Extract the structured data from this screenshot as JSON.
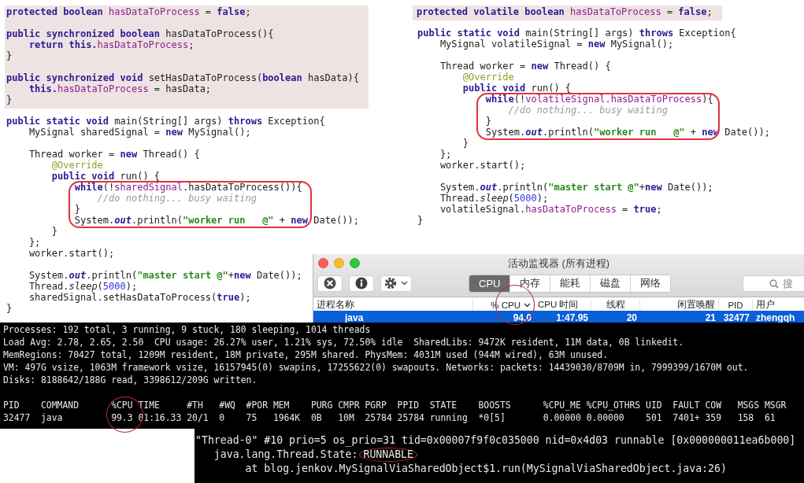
{
  "snippets": [
    {
      "blocks": [
        {
          "kind": "shaded",
          "lines": [
            {
              "kind": "code",
              "segments": [
                {
                  "kind": "kw",
                  "text": "protected boolean "
                },
                {
                  "kind": "field",
                  "text": "hasDataToProcess"
                },
                {
                  "kind": "plain",
                  "text": " = "
                },
                {
                  "kind": "kw",
                  "text": "false"
                },
                {
                  "kind": "plain",
                  "text": ";"
                }
              ]
            },
            {
              "kind": "blank"
            },
            {
              "kind": "code",
              "segments": [
                {
                  "kind": "kw",
                  "text": "public synchronized boolean "
                },
                {
                  "kind": "plain",
                  "text": "hasDataToProcess(){"
                }
              ]
            },
            {
              "kind": "code",
              "segments": [
                {
                  "kind": "kw",
                  "text": "    return this."
                },
                {
                  "kind": "field",
                  "text": "hasDataToProcess"
                },
                {
                  "kind": "plain",
                  "text": ";"
                }
              ]
            },
            {
              "kind": "code",
              "segments": [
                {
                  "kind": "plain",
                  "text": "}"
                }
              ]
            },
            {
              "kind": "blank"
            },
            {
              "kind": "code",
              "segments": [
                {
                  "kind": "kw",
                  "text": "public synchronized void "
                },
                {
                  "kind": "plain",
                  "text": "setHasDataToProcess("
                },
                {
                  "kind": "kw",
                  "text": "boolean"
                },
                {
                  "kind": "plain",
                  "text": " hasData){"
                }
              ]
            },
            {
              "kind": "code",
              "segments": [
                {
                  "kind": "kw",
                  "text": "    this."
                },
                {
                  "kind": "field",
                  "text": "hasDataToProcess"
                },
                {
                  "kind": "plain",
                  "text": " = hasData;"
                }
              ]
            },
            {
              "kind": "code",
              "segments": [
                {
                  "kind": "plain",
                  "text": "}"
                }
              ]
            }
          ]
        },
        {
          "kind": "plain",
          "lines": [
            {
              "kind": "blank"
            },
            {
              "kind": "code",
              "segments": [
                {
                  "kind": "kw",
                  "text": "public static void "
                },
                {
                  "kind": "plain",
                  "text": "main(String[] args) "
                },
                {
                  "kind": "kw",
                  "text": "throws"
                },
                {
                  "kind": "plain",
                  "text": " Exception{"
                }
              ]
            },
            {
              "kind": "code",
              "segments": [
                {
                  "kind": "plain",
                  "text": "    MySignal sharedSignal = "
                },
                {
                  "kind": "kw",
                  "text": "new"
                },
                {
                  "kind": "plain",
                  "text": " MySignal();"
                }
              ]
            },
            {
              "kind": "blank"
            },
            {
              "kind": "code",
              "segments": [
                {
                  "kind": "plain",
                  "text": "    Thread worker = "
                },
                {
                  "kind": "kw",
                  "text": "new"
                },
                {
                  "kind": "plain",
                  "text": " Thread() {"
                }
              ]
            },
            {
              "kind": "code",
              "segments": [
                {
                  "kind": "annotation",
                  "text": "        @Override"
                }
              ]
            },
            {
              "kind": "code",
              "segments": [
                {
                  "kind": "kw",
                  "text": "        public void"
                },
                {
                  "kind": "plain",
                  "text": " run() {"
                }
              ]
            }
          ]
        },
        {
          "kind": "circled",
          "lines": [
            {
              "kind": "code",
              "segments": [
                {
                  "kind": "kw",
                  "text": "            while"
                },
                {
                  "kind": "plain",
                  "text": "(!"
                },
                {
                  "kind": "field",
                  "text": "sharedSignal"
                },
                {
                  "kind": "plain",
                  "text": ".hasDataToProcess()){"
                }
              ]
            },
            {
              "kind": "code",
              "segments": [
                {
                  "kind": "comment",
                  "text": "                //do nothing... busy waiting"
                }
              ]
            },
            {
              "kind": "code",
              "segments": [
                {
                  "kind": "plain",
                  "text": "            }"
                }
              ]
            },
            {
              "kind": "code",
              "segments": [
                {
                  "kind": "plain",
                  "text": "            System."
                },
                {
                  "kind": "static_field",
                  "text": "out"
                },
                {
                  "kind": "plain",
                  "text": ".println("
                },
                {
                  "kind": "string",
                  "text": "\"worker run   @\""
                },
                {
                  "kind": "plain",
                  "text": " + "
                },
                {
                  "kind": "kw",
                  "text": "new"
                },
                {
                  "kind": "plain",
                  "text": " Date());"
                }
              ]
            }
          ]
        },
        {
          "kind": "plain",
          "lines": [
            {
              "kind": "code",
              "segments": [
                {
                  "kind": "plain",
                  "text": "        }"
                }
              ]
            },
            {
              "kind": "code",
              "segments": [
                {
                  "kind": "plain",
                  "text": "    };"
                }
              ]
            },
            {
              "kind": "code",
              "segments": [
                {
                  "kind": "plain",
                  "text": "    worker.start();"
                }
              ]
            },
            {
              "kind": "blank"
            },
            {
              "kind": "code",
              "segments": [
                {
                  "kind": "plain",
                  "text": "    System."
                },
                {
                  "kind": "static_field",
                  "text": "out"
                },
                {
                  "kind": "plain",
                  "text": ".println("
                },
                {
                  "kind": "string",
                  "text": "\"master start @\""
                },
                {
                  "kind": "plain",
                  "text": "+"
                },
                {
                  "kind": "kw",
                  "text": "new"
                },
                {
                  "kind": "plain",
                  "text": " Date());"
                }
              ]
            },
            {
              "kind": "code",
              "segments": [
                {
                  "kind": "plain",
                  "text": "    Thread."
                },
                {
                  "kind": "static_method",
                  "text": "sleep"
                },
                {
                  "kind": "plain",
                  "text": "("
                },
                {
                  "kind": "number",
                  "text": "5000"
                },
                {
                  "kind": "plain",
                  "text": ");"
                }
              ]
            },
            {
              "kind": "code",
              "segments": [
                {
                  "kind": "plain",
                  "text": "    sharedSignal.setHasDataToProcess("
                },
                {
                  "kind": "kw",
                  "text": "true"
                },
                {
                  "kind": "plain",
                  "text": ");"
                }
              ]
            },
            {
              "kind": "code",
              "segments": [
                {
                  "kind": "plain",
                  "text": "}"
                }
              ]
            }
          ]
        }
      ]
    },
    {
      "blocks": [
        {
          "kind": "shaded",
          "lines": [
            {
              "kind": "code",
              "segments": [
                {
                  "kind": "kw",
                  "text": "protected volatile boolean "
                },
                {
                  "kind": "field",
                  "text": "hasDataToProcess"
                },
                {
                  "kind": "plain",
                  "text": " = "
                },
                {
                  "kind": "kw",
                  "text": "false"
                },
                {
                  "kind": "plain",
                  "text": ";"
                }
              ]
            }
          ]
        },
        {
          "kind": "plain",
          "lines": [
            {
              "kind": "blank"
            },
            {
              "kind": "code",
              "segments": [
                {
                  "kind": "kw",
                  "text": "public static void "
                },
                {
                  "kind": "plain",
                  "text": "main(String[] args) "
                },
                {
                  "kind": "kw",
                  "text": "throws"
                },
                {
                  "kind": "plain",
                  "text": " Exception{"
                }
              ]
            },
            {
              "kind": "code",
              "segments": [
                {
                  "kind": "plain",
                  "text": "    MySignal volatileSignal = "
                },
                {
                  "kind": "kw",
                  "text": "new"
                },
                {
                  "kind": "plain",
                  "text": " MySignal();"
                }
              ]
            },
            {
              "kind": "blank"
            },
            {
              "kind": "code",
              "segments": [
                {
                  "kind": "plain",
                  "text": "    Thread worker = "
                },
                {
                  "kind": "kw",
                  "text": "new"
                },
                {
                  "kind": "plain",
                  "text": " Thread() {"
                }
              ]
            },
            {
              "kind": "code",
              "segments": [
                {
                  "kind": "annotation",
                  "text": "        @Override"
                }
              ]
            },
            {
              "kind": "code",
              "segments": [
                {
                  "kind": "kw",
                  "text": "        public void"
                },
                {
                  "kind": "plain",
                  "text": " run() {"
                }
              ]
            }
          ]
        },
        {
          "kind": "circled",
          "lines": [
            {
              "kind": "code",
              "segments": [
                {
                  "kind": "kw",
                  "text": "            while"
                },
                {
                  "kind": "plain",
                  "text": "(!"
                },
                {
                  "kind": "field",
                  "text": "volatileSignal.hasDataToProcess"
                },
                {
                  "kind": "plain",
                  "text": "){"
                }
              ]
            },
            {
              "kind": "code",
              "segments": [
                {
                  "kind": "comment",
                  "text": "                //do nothing... busy waiting"
                }
              ]
            },
            {
              "kind": "code",
              "segments": [
                {
                  "kind": "plain",
                  "text": "            }"
                }
              ]
            },
            {
              "kind": "code",
              "segments": [
                {
                  "kind": "plain",
                  "text": "            System."
                },
                {
                  "kind": "static_field",
                  "text": "out"
                },
                {
                  "kind": "plain",
                  "text": ".println("
                },
                {
                  "kind": "string",
                  "text": "\"worker run   @\""
                },
                {
                  "kind": "plain",
                  "text": " + "
                },
                {
                  "kind": "kw",
                  "text": "new"
                },
                {
                  "kind": "plain",
                  "text": " Date());"
                }
              ]
            }
          ]
        },
        {
          "kind": "plain",
          "lines": [
            {
              "kind": "code",
              "segments": [
                {
                  "kind": "plain",
                  "text": "        }"
                }
              ]
            },
            {
              "kind": "code",
              "segments": [
                {
                  "kind": "plain",
                  "text": "    };"
                }
              ]
            },
            {
              "kind": "code",
              "segments": [
                {
                  "kind": "plain",
                  "text": "    worker.start();"
                }
              ]
            },
            {
              "kind": "blank"
            },
            {
              "kind": "code",
              "segments": [
                {
                  "kind": "plain",
                  "text": "    System."
                },
                {
                  "kind": "static_field",
                  "text": "out"
                },
                {
                  "kind": "plain",
                  "text": ".println("
                },
                {
                  "kind": "string",
                  "text": "\"master start @\""
                },
                {
                  "kind": "plain",
                  "text": "+"
                },
                {
                  "kind": "kw",
                  "text": "new"
                },
                {
                  "kind": "plain",
                  "text": " Date());"
                }
              ]
            },
            {
              "kind": "code",
              "segments": [
                {
                  "kind": "plain",
                  "text": "    Thread."
                },
                {
                  "kind": "static_method",
                  "text": "sleep"
                },
                {
                  "kind": "plain",
                  "text": "("
                },
                {
                  "kind": "number",
                  "text": "5000"
                },
                {
                  "kind": "plain",
                  "text": ");"
                }
              ]
            },
            {
              "kind": "code",
              "segments": [
                {
                  "kind": "plain",
                  "text": "    volatileSignal."
                },
                {
                  "kind": "field",
                  "text": "hasDataToProcess"
                },
                {
                  "kind": "plain",
                  "text": " = "
                },
                {
                  "kind": "kw",
                  "text": "true"
                },
                {
                  "kind": "plain",
                  "text": ";"
                }
              ]
            },
            {
              "kind": "code",
              "segments": [
                {
                  "kind": "plain",
                  "text": "}"
                }
              ]
            }
          ]
        }
      ]
    }
  ],
  "activity_monitor": {
    "title": "活动监视器 (所有进程)",
    "tabs": [
      {
        "label": "CPU",
        "selected": true
      },
      {
        "label": "内存",
        "selected": false
      },
      {
        "label": "能耗",
        "selected": false
      },
      {
        "label": "磁盘",
        "selected": false
      },
      {
        "label": "网络",
        "selected": false
      }
    ],
    "search": {
      "placeholder": "搜"
    },
    "columns": [
      {
        "label": "进程名称",
        "sorted": false
      },
      {
        "label": "% CPU",
        "sorted": true
      },
      {
        "label": "CPU 时间",
        "sorted": false
      },
      {
        "label": "线程",
        "sorted": false
      },
      {
        "label": "闲置唤醒",
        "sorted": false
      },
      {
        "label": "PID",
        "sorted": false
      },
      {
        "label": "用户",
        "sorted": false
      }
    ],
    "rows": [
      {
        "selected": true,
        "cells": [
          "java",
          "94.0",
          "1:47.95",
          "20",
          "21",
          "32477",
          "zhengqh"
        ]
      }
    ]
  },
  "top_output": {
    "lines": [
      {
        "kind": "text",
        "text": "Processes: 192 total, 3 running, 9 stuck, 180 sleeping, 1014 threads"
      },
      {
        "kind": "text",
        "text": "Load Avg: 2.78, 2.65, 2.50  CPU usage: 26.27% user, 1.21% sys, 72.50% idle  SharedLibs: 9472K resident, 11M data, 0B linkedit."
      },
      {
        "kind": "text",
        "text": "MemRegions: 70427 total, 1209M resident, 18M private, 295M shared. PhysMem: 4031M used (944M wired), 63M unused."
      },
      {
        "kind": "text",
        "text": "VM: 497G vsize, 1063M framework vsize, 16157945(0) swapins, 17255622(0) swapouts. Networks: packets: 14439030/8709M in, 7999399/1670M out."
      },
      {
        "kind": "text",
        "text": "Disks: 8188642/188G read, 3398612/209G written."
      },
      {
        "kind": "blank"
      },
      {
        "kind": "text",
        "text": "PID    COMMAND      %CPU TIME     #TH   #WQ  #POR MEM    PURG CMPR PGRP  PPID  STATE    BOOSTS      %CPU_ME %CPU_OTHRS UID  FAULT COW   MSGS MSGR"
      },
      {
        "kind": "text",
        "text": "32477  java         99.3 01:16.33 20/1  0    75   1964K  0B   10M  25784 25784 running  *0[5]       0.00000 0.00000    501  7401+ 359   158  61"
      }
    ]
  },
  "thread_dump": {
    "lines": [
      {
        "text": "\"Thread-0\" #10 prio=5 os_prio=31 tid=0x00007f9f0c035000 nid=0x4d03 runnable [0x000000011ea6b000]"
      },
      {
        "text": "   java.lang.Thread.State:",
        "highlighted_word": "RUNNABLE"
      },
      {
        "text": "        at blog.jenkov.MySignalViaSharedObject$1.run(MySignalViaSharedObject.java:26)"
      }
    ]
  }
}
